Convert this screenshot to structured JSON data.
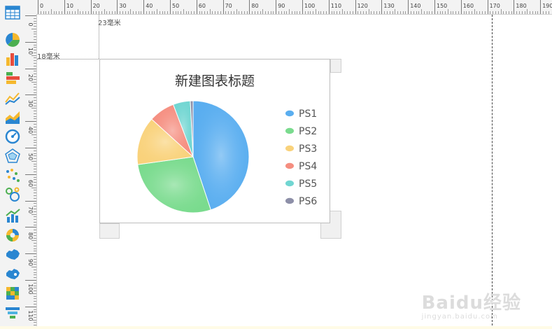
{
  "toolbar": {
    "tools": [
      {
        "name": "table-tool",
        "icon": "table-icon"
      },
      {
        "name": "pie-chart-tool",
        "icon": "pie-chart-icon"
      },
      {
        "name": "column-chart-tool",
        "icon": "column-chart-icon"
      },
      {
        "name": "bar-chart-tool",
        "icon": "bar-chart-icon"
      },
      {
        "name": "line-chart-tool",
        "icon": "line-chart-icon"
      },
      {
        "name": "area-chart-tool",
        "icon": "area-chart-icon"
      },
      {
        "name": "gauge-chart-tool",
        "icon": "gauge-icon"
      },
      {
        "name": "radar-chart-tool",
        "icon": "radar-icon"
      },
      {
        "name": "scatter-chart-tool",
        "icon": "scatter-icon"
      },
      {
        "name": "bubble-chart-tool",
        "icon": "bubble-icon"
      },
      {
        "name": "combo-chart-tool",
        "icon": "combo-chart-icon"
      },
      {
        "name": "ring-chart-tool",
        "icon": "ring-chart-icon"
      },
      {
        "name": "map-chart-tool",
        "icon": "china-map-icon"
      },
      {
        "name": "map-chart-alt-tool",
        "icon": "china-map-alt-icon"
      },
      {
        "name": "heatmap-tool",
        "icon": "heatmap-icon"
      },
      {
        "name": "funnel-chart-tool",
        "icon": "funnel-icon"
      }
    ]
  },
  "ruler": {
    "top_labels": [
      "0",
      "10",
      "20",
      "30",
      "40",
      "50",
      "60",
      "70",
      "80",
      "90",
      "100",
      "110",
      "120",
      "130",
      "140",
      "150",
      "160",
      "170",
      "180",
      "190"
    ],
    "left_labels": [
      "0",
      "10",
      "20",
      "30",
      "40",
      "50",
      "60",
      "70",
      "80",
      "90",
      "100",
      "110"
    ]
  },
  "guides": {
    "left_offset_label": "23毫米",
    "top_offset_label": "18毫米"
  },
  "chart": {
    "title": "新建图表标题"
  },
  "chart_data": {
    "type": "pie",
    "title": "新建图表标题",
    "categories": [
      "PS1",
      "PS2",
      "PS3",
      "PS4",
      "PS5",
      "PS6"
    ],
    "values": [
      45,
      28,
      14,
      7.5,
      5,
      0.8
    ],
    "colors": [
      "#5aaef0",
      "#7adb8e",
      "#f9d27b",
      "#f58e80",
      "#71d6d2",
      "#8d8fa8"
    ],
    "legend": "right"
  },
  "watermark": {
    "main": "Baidu经验",
    "sub": "jingyan.baidu.com"
  }
}
